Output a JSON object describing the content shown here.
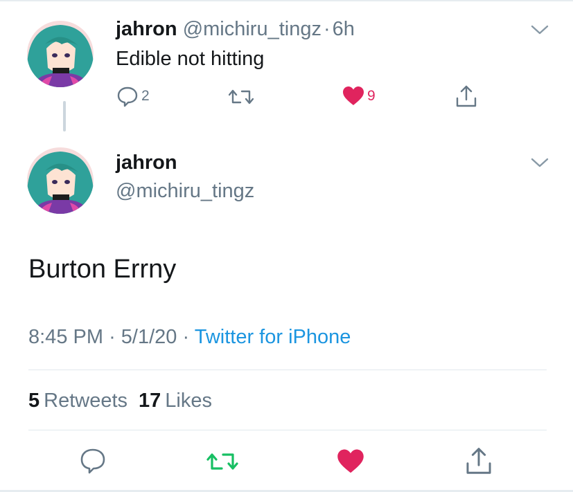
{
  "parent_tweet": {
    "display_name": "jahron",
    "handle": "@michiru_tingz",
    "separator": "·",
    "time_ago": "6h",
    "text": "Edible not hitting",
    "reply_count": "2",
    "like_count": "9"
  },
  "main_tweet": {
    "display_name": "jahron",
    "handle": "@michiru_tingz",
    "text": "Burton Errny",
    "time": "8:45 PM",
    "date": "5/1/20",
    "separator": "·",
    "source": "Twitter for iPhone",
    "retweets_count": "5",
    "retweets_label": "Retweets",
    "likes_count": "17",
    "likes_label": "Likes"
  },
  "colors": {
    "like_red": "#e0245e",
    "retweet_green": "#17bf63",
    "link_blue": "#1b95e0",
    "muted_gray": "#657786"
  },
  "icons": [
    "chevron-down-icon",
    "reply-icon",
    "retweet-icon",
    "heart-icon",
    "share-icon"
  ]
}
